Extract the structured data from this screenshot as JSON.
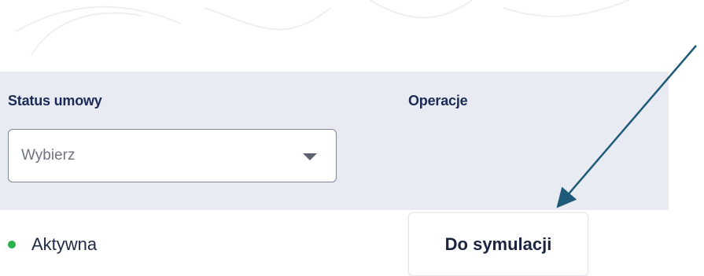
{
  "table": {
    "headers": {
      "status": "Status umowy",
      "operations": "Operacje"
    },
    "filter": {
      "placeholder": "Wybierz"
    },
    "row": {
      "status": "Aktywna",
      "status_color": "#2bb24c",
      "action_label": "Do symulacji"
    }
  },
  "colors": {
    "header_band": "#e8ebf1",
    "header_text": "#1c2b55",
    "arrow": "#1f5a78"
  }
}
